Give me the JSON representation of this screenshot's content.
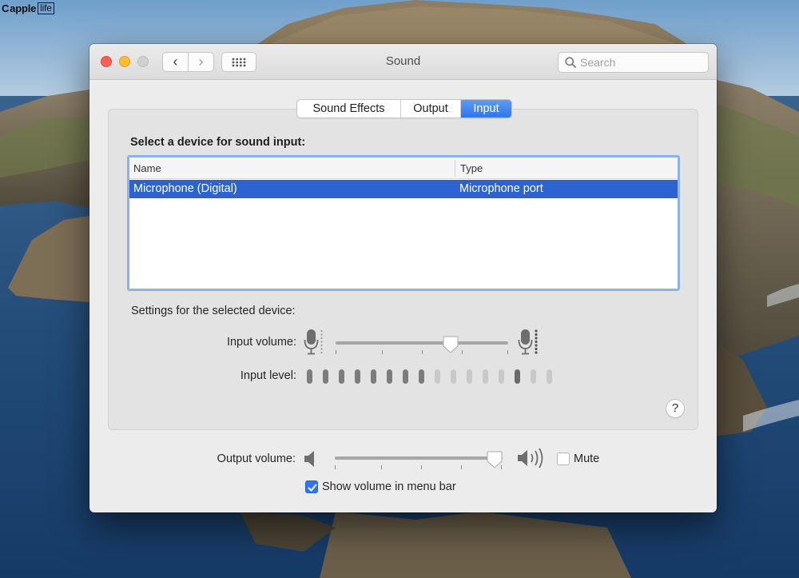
{
  "watermark": {
    "logo": "C",
    "text_before": "apple",
    "text_boxed": "life"
  },
  "window": {
    "title": "Sound"
  },
  "toolbar": {
    "back_glyph": "‹",
    "forward_glyph": "›",
    "search_placeholder": "Search"
  },
  "tabs": [
    {
      "label": "Sound Effects",
      "active": false
    },
    {
      "label": "Output",
      "active": false
    },
    {
      "label": "Input",
      "active": true
    }
  ],
  "input": {
    "section_title": "Select a device for sound input:",
    "table": {
      "columns": [
        "Name",
        "Type"
      ],
      "rows": [
        {
          "name": "Microphone (Digital)",
          "type": "Microphone port",
          "selected": true
        }
      ]
    },
    "settings_label": "Settings for the selected device:",
    "input_volume_label": "Input volume:",
    "input_volume_value": 0.7,
    "input_level_label": "Input level:",
    "input_level_segments": [
      "on",
      "on",
      "on",
      "on",
      "on",
      "on",
      "on",
      "on",
      "off",
      "off",
      "off",
      "off",
      "off",
      "peak",
      "off",
      "off"
    ],
    "help_label": "?"
  },
  "output": {
    "output_volume_label": "Output volume:",
    "output_volume_value": 1.0,
    "mute_label": "Mute",
    "mute_checked": false,
    "show_volume_label": "Show volume in menu bar",
    "show_volume_checked": true
  },
  "colors": {
    "accent": "#2f76ee",
    "selection": "#2c63d1",
    "table_focus_ring": "#8cb2ea",
    "close": "#fc5f57",
    "minimize": "#fdbc2e",
    "zoom": "#d0d0d0"
  }
}
